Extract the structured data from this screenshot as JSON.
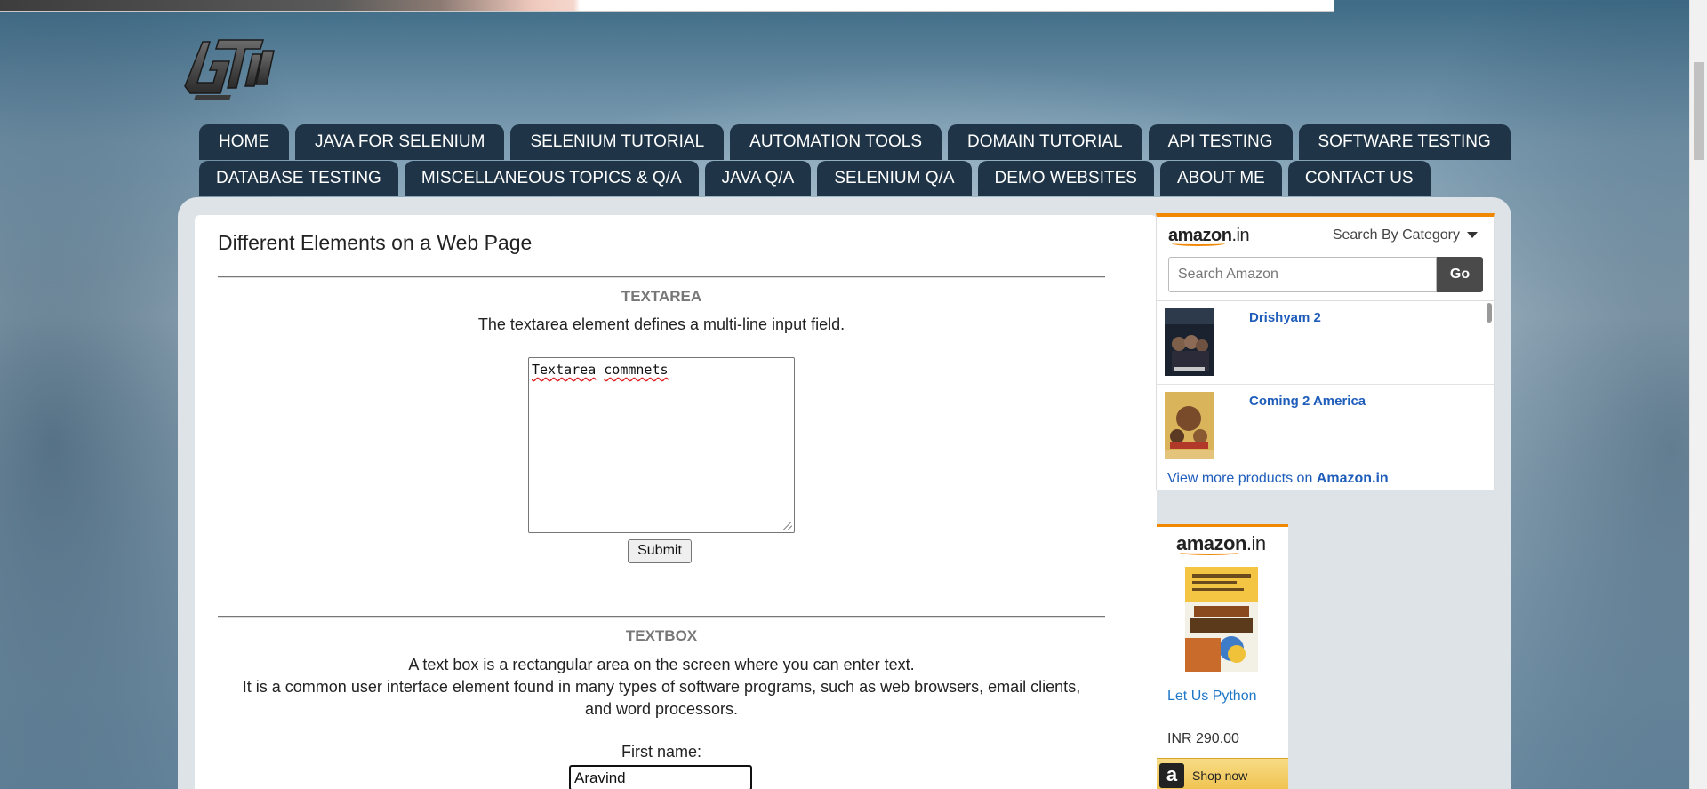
{
  "nav": {
    "row1": [
      "HOME",
      "JAVA FOR SELENIUM",
      "SELENIUM TUTORIAL",
      "AUTOMATION TOOLS",
      "DOMAIN TUTORIAL",
      "API TESTING",
      "SOFTWARE TESTING"
    ],
    "row2": [
      "DATABASE TESTING",
      "MISCELLANEOUS TOPICS & Q/A",
      "JAVA Q/A",
      "SELENIUM Q/A",
      "DEMO WEBSITES",
      "ABOUT ME",
      "CONTACT US"
    ]
  },
  "main": {
    "title": "Different Elements on a Web Page",
    "textarea_section": {
      "heading": "TEXTAREA",
      "description": "The textarea element defines a multi-line input field.",
      "value_word1": "Textarea",
      "value_word2": "commnets",
      "submit_label": "Submit"
    },
    "textbox_section": {
      "heading": "TEXTBOX",
      "description_line1": "A text box is a rectangular area on the screen where you can enter text.",
      "description_line2": "It is a common user interface element found in many types of software programs, such as web browsers, email clients,",
      "description_line3": "and word processors.",
      "first_name_label": "First name:",
      "first_name_value": "Aravind"
    }
  },
  "amazon_search_widget": {
    "logo": "amazon",
    "logo_suffix": ".in",
    "category": "Search By Category",
    "search_placeholder": "Search Amazon",
    "go_label": "Go",
    "items": [
      {
        "title": "Drishyam 2"
      },
      {
        "title": "Coming 2 America"
      }
    ],
    "more_text": "View more products on ",
    "more_link": "Amazon.in"
  },
  "amazon_product_widget": {
    "logo": "amazon",
    "logo_suffix": ".in",
    "product_title": "Let Us Python",
    "price": "INR 290.00",
    "shop_label": "Shop now",
    "shop_icon_letter": "a"
  },
  "colors": {
    "nav_bg": "#1f3547",
    "amazon_orange": "#f08804",
    "link_blue": "#1f5dbb"
  }
}
